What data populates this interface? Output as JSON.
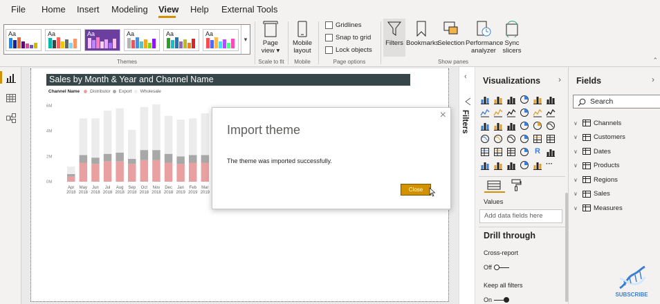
{
  "menu": {
    "tabs": [
      "File",
      "Home",
      "Insert",
      "Modeling",
      "View",
      "Help",
      "External Tools"
    ],
    "active": "View"
  },
  "ribbon": {
    "themes_label": "Themes",
    "theme_aa": "Aa",
    "page_view": "Page view",
    "page_view_line1": "Page",
    "page_view_line2": "view",
    "scale_to_fit": "Scale to fit",
    "mobile_layout_line1": "Mobile",
    "mobile_layout_line2": "layout",
    "mobile_label": "Mobile",
    "gridlines": "Gridlines",
    "snap_to_grid": "Snap to grid",
    "lock_objects": "Lock objects",
    "page_options": "Page options",
    "filters": "Filters",
    "bookmarks": "Bookmarks",
    "selection": "Selection",
    "performance_line1": "Performance",
    "performance_line2": "analyzer",
    "sync_line1": "Sync",
    "sync_line2": "slicers",
    "show_panes": "Show panes"
  },
  "colors": {
    "accent": "#d29200",
    "title_bar": "#374649",
    "distributor": "#e8a0a0",
    "export": "#a8a8a8",
    "wholesale": "#ececec",
    "theme_selected": "#6b3fa0"
  },
  "report": {
    "chart_title": "Sales by Month & Year and Channel Name",
    "legend_title": "Channel Name",
    "legend_items": [
      "Distributor",
      "Export",
      "Wholesale"
    ]
  },
  "chart_data": {
    "type": "bar",
    "stacked": true,
    "title": "Sales by Month & Year and Channel Name",
    "ylabel": "Sales",
    "xlabel": "",
    "ylim": [
      0,
      6
    ],
    "yticks": [
      "6M",
      "4M",
      "2M",
      "0M"
    ],
    "categories": [
      [
        "Apr",
        "2018"
      ],
      [
        "May",
        "2018"
      ],
      [
        "Jun",
        "2018"
      ],
      [
        "Jul",
        "2018"
      ],
      [
        "Aug",
        "2018"
      ],
      [
        "Sep",
        "2018"
      ],
      [
        "Oct",
        "2018"
      ],
      [
        "Nov",
        "2018"
      ],
      [
        "Dec",
        "2018"
      ],
      [
        "Jan",
        "2019"
      ],
      [
        "Feb",
        "2019"
      ],
      [
        "Mar",
        "2019"
      ],
      [
        "Apr",
        "2019"
      ],
      [
        "Ma",
        "20"
      ]
    ],
    "legend_position": "top-left",
    "series": [
      {
        "name": "Distributor",
        "values": [
          0.4,
          1.5,
          1.4,
          1.6,
          1.6,
          1.4,
          1.7,
          1.7,
          1.5,
          1.4,
          1.5,
          1.5,
          1.4,
          1.5
        ]
      },
      {
        "name": "Export",
        "values": [
          0.2,
          0.6,
          0.5,
          0.6,
          0.7,
          0.4,
          0.8,
          0.8,
          0.7,
          0.6,
          0.6,
          0.6,
          0.6,
          0.6
        ]
      },
      {
        "name": "Wholesale",
        "values": [
          0.6,
          2.9,
          3.1,
          3.4,
          3.5,
          2.3,
          3.4,
          3.6,
          3.0,
          2.9,
          2.9,
          3.3,
          2.0,
          2.3
        ]
      }
    ]
  },
  "dialog": {
    "title": "Import theme",
    "message": "The theme was imported successfully.",
    "close_label": "Close",
    "close_glyph": "×"
  },
  "filters": {
    "label": "Filters"
  },
  "visualizations": {
    "title": "Visualizations",
    "values_label": "Values",
    "add_fields_placeholder": "Add data fields here",
    "drill_through": "Drill through",
    "cross_report": "Cross-report",
    "cross_report_state": "Off",
    "keep_all_filters": "Keep all filters",
    "keep_all_filters_state": "On",
    "r_glyph": "R",
    "more_glyph": "···"
  },
  "fields": {
    "title": "Fields",
    "search_placeholder": "Search",
    "tables": [
      "Channels",
      "Customers",
      "Dates",
      "Products",
      "Regions",
      "Sales",
      "Measures"
    ]
  },
  "watermark": {
    "subscribe": "SUBSCRIBE"
  }
}
